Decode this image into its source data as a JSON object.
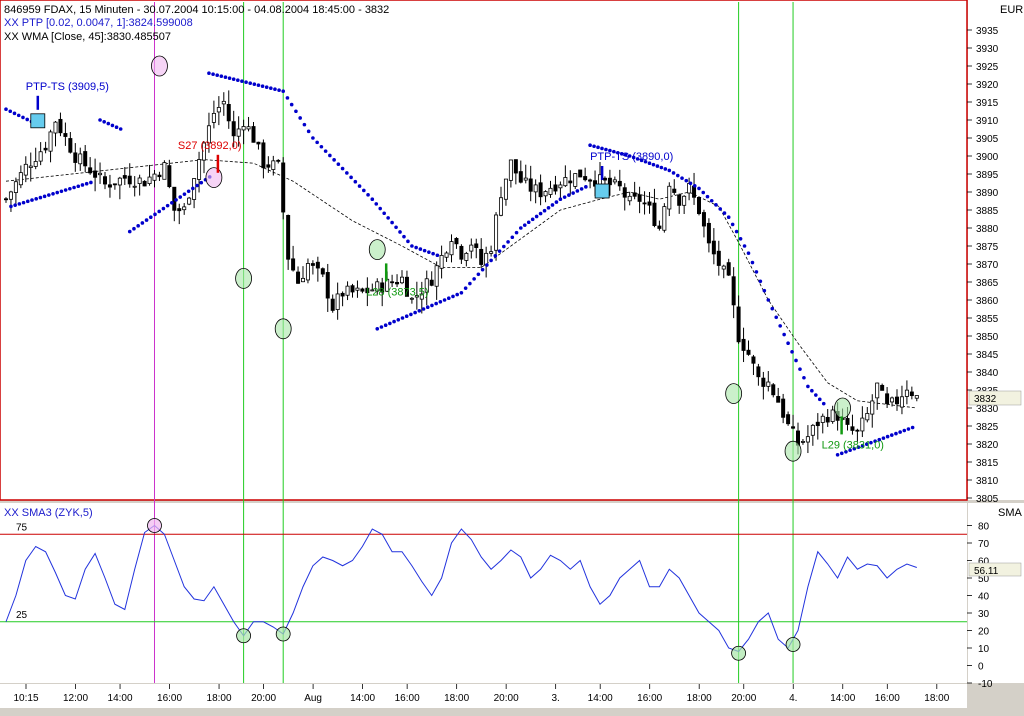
{
  "header": {
    "line1": "846959  FDAX, 15 Minuten - 30.07.2004 10:15:00 - 04.08.2004 18:45:00 - 3832",
    "line2": "XX PTP [0.02, 0.0047, 1]:3824.599008",
    "line3": "XX WMA [Close, 45]:3830.485507",
    "currency": "EUR"
  },
  "lower_header": {
    "title": "XX  SMA3 (ZYK,5)",
    "axis_title": "SMA"
  },
  "colors": {
    "candle": "#000000",
    "ptp_dots": "#0000cc",
    "wma": "#000000",
    "sma_line": "#2233dd",
    "level_line": "#cc0000",
    "green_lines": "#22cc22",
    "magenta_line": "#cc33cc",
    "short_signal": "#dd0000",
    "long_signal": "#119911",
    "circle_fill": "#a8e6a8",
    "pink_circle_fill": "#f0b8f0",
    "marker_fill": "#66ccee",
    "border_red": "#cc0000"
  },
  "chart_data": [
    {
      "type": "candlestick",
      "title": "846959  FDAX, 15 Minuten - 30.07.2004 10:15:00 - 04.08.2004 18:45:00 - 3832",
      "ylim": [
        3805,
        3940
      ],
      "yticks": [
        3805,
        3810,
        3815,
        3820,
        3825,
        3830,
        3835,
        3840,
        3845,
        3850,
        3855,
        3860,
        3865,
        3870,
        3875,
        3880,
        3885,
        3890,
        3895,
        3900,
        3905,
        3910,
        3915,
        3920,
        3925,
        3930,
        3935
      ],
      "xticks": [
        "10:15",
        "12:00",
        "14:00",
        "16:00",
        "18:00",
        "20:00",
        "Aug",
        "14:00",
        "16:00",
        "18:00",
        "20:00",
        "3.",
        "14:00",
        "16:00",
        "18:00",
        "20:00",
        "4.",
        "14:00",
        "16:00",
        "18:00"
      ],
      "last_value": "3832",
      "close_profile": [
        [
          0,
          3888
        ],
        [
          4,
          3897
        ],
        [
          8,
          3903
        ],
        [
          10,
          3910
        ],
        [
          14,
          3900
        ],
        [
          18,
          3895
        ],
        [
          20,
          3892
        ],
        [
          24,
          3894
        ],
        [
          28,
          3893
        ],
        [
          32,
          3897
        ],
        [
          34,
          3885
        ],
        [
          36,
          3885
        ],
        [
          38,
          3895
        ],
        [
          42,
          3912
        ],
        [
          44,
          3915
        ],
        [
          46,
          3905
        ],
        [
          48,
          3910
        ],
        [
          50,
          3905
        ],
        [
          52,
          3898
        ],
        [
          55,
          3897
        ],
        [
          57,
          3872
        ],
        [
          59,
          3865
        ],
        [
          61,
          3870
        ],
        [
          64,
          3866
        ],
        [
          66,
          3858
        ],
        [
          68,
          3862
        ],
        [
          72,
          3862
        ],
        [
          76,
          3864
        ],
        [
          80,
          3866
        ],
        [
          82,
          3860
        ],
        [
          84,
          3863
        ],
        [
          86,
          3866
        ],
        [
          88,
          3872
        ],
        [
          90,
          3878
        ],
        [
          92,
          3873
        ],
        [
          94,
          3876
        ],
        [
          96,
          3870
        ],
        [
          98,
          3875
        ],
        [
          100,
          3890
        ],
        [
          102,
          3898
        ],
        [
          104,
          3893
        ],
        [
          106,
          3891
        ],
        [
          108,
          3890
        ],
        [
          112,
          3893
        ],
        [
          116,
          3895
        ],
        [
          120,
          3893
        ],
        [
          124,
          3891
        ],
        [
          126,
          3887
        ],
        [
          128,
          3888
        ],
        [
          130,
          3885
        ],
        [
          132,
          3880
        ],
        [
          134,
          3893
        ],
        [
          136,
          3888
        ],
        [
          138,
          3891
        ],
        [
          140,
          3885
        ],
        [
          142,
          3875
        ],
        [
          144,
          3870
        ],
        [
          146,
          3865
        ],
        [
          148,
          3850
        ],
        [
          150,
          3845
        ],
        [
          152,
          3838
        ],
        [
          154,
          3837
        ],
        [
          156,
          3832
        ],
        [
          158,
          3825
        ],
        [
          160,
          3820
        ],
        [
          162,
          3822
        ],
        [
          164,
          3826
        ],
        [
          166,
          3828
        ],
        [
          168,
          3828
        ],
        [
          170,
          3824
        ],
        [
          172,
          3823
        ],
        [
          174,
          3828
        ],
        [
          176,
          3836
        ],
        [
          178,
          3830
        ],
        [
          180,
          3832
        ],
        [
          182,
          3836
        ],
        [
          184,
          3833
        ]
      ],
      "wma_values": [
        [
          0,
          3893
        ],
        [
          20,
          3896
        ],
        [
          40,
          3899
        ],
        [
          50,
          3898
        ],
        [
          58,
          3893
        ],
        [
          70,
          3882
        ],
        [
          80,
          3875
        ],
        [
          88,
          3869
        ],
        [
          96,
          3869
        ],
        [
          104,
          3877
        ],
        [
          112,
          3885
        ],
        [
          120,
          3888
        ],
        [
          126,
          3890
        ],
        [
          132,
          3888
        ],
        [
          138,
          3890
        ],
        [
          144,
          3886
        ],
        [
          148,
          3876
        ],
        [
          154,
          3860
        ],
        [
          160,
          3848
        ],
        [
          166,
          3837
        ],
        [
          172,
          3832
        ],
        [
          178,
          3831
        ],
        [
          184,
          3830
        ]
      ],
      "series": [
        {
          "name": "PTP [0.02, 0.0047, 1]",
          "last": "3824.599008",
          "segments": [
            [
              [
                0,
                3913
              ],
              [
                6,
                3909
              ]
            ],
            [
              [
                1,
                3886
              ],
              [
                18,
                3893
              ]
            ],
            [
              [
                19,
                3910
              ],
              [
                24,
                3907
              ]
            ],
            [
              [
                25,
                3879
              ],
              [
                42,
                3895
              ]
            ],
            [
              [
                41,
                3923
              ],
              [
                56,
                3918
              ],
              [
                62,
                3905
              ],
              [
                74,
                3888
              ],
              [
                82,
                3875
              ],
              [
                88,
                3872
              ]
            ],
            [
              [
                75,
                3852
              ],
              [
                92,
                3862
              ],
              [
                104,
                3880
              ],
              [
                112,
                3888
              ],
              [
                118,
                3892
              ]
            ],
            [
              [
                118,
                3903
              ],
              [
                126,
                3900
              ],
              [
                134,
                3896
              ],
              [
                140,
                3891
              ],
              [
                146,
                3883
              ],
              [
                150,
                3873
              ],
              [
                154,
                3860
              ],
              [
                158,
                3848
              ],
              [
                162,
                3836
              ],
              [
                166,
                3830
              ]
            ],
            [
              [
                168,
                3817
              ],
              [
                184,
                3825
              ]
            ]
          ]
        },
        {
          "name": "WMA [Close, 45]",
          "last": "3830.485507"
        }
      ],
      "annotations": [
        {
          "text": "PTP-TS (3909,5)",
          "x": 4,
          "y": 3909.5,
          "kind": "ptp"
        },
        {
          "text": "S27 (3892,0)",
          "x": 42,
          "y": 3892,
          "kind": "short"
        },
        {
          "text": "L28 (3873,5)",
          "x": 76,
          "y": 3873.5,
          "kind": "long"
        },
        {
          "text": "PTP-TS (3890,0)",
          "x": 118,
          "y": 3890,
          "kind": "ptp"
        },
        {
          "text": "L29 (3831,0)",
          "x": 168,
          "y": 3831,
          "kind": "long"
        }
      ],
      "circle_points": [
        {
          "x": 31,
          "y": 3925,
          "kind": "pink"
        },
        {
          "x": 42,
          "y": 3894,
          "kind": "pink"
        },
        {
          "x": 48,
          "y": 3866,
          "kind": "green"
        },
        {
          "x": 56,
          "y": 3852,
          "kind": "green"
        },
        {
          "x": 75,
          "y": 3874,
          "kind": "green"
        },
        {
          "x": 147,
          "y": 3834,
          "kind": "green"
        },
        {
          "x": 159,
          "y": 3818,
          "kind": "green"
        },
        {
          "x": 169,
          "y": 3830,
          "kind": "green"
        }
      ]
    },
    {
      "type": "line",
      "title": "XX  SMA3 (ZYK,5)",
      "ylim": [
        -10,
        90
      ],
      "yticks": [
        -10,
        0,
        10,
        20,
        30,
        40,
        50,
        60,
        70,
        80
      ],
      "levels": [
        {
          "value": 75,
          "label": "75"
        },
        {
          "value": 25,
          "label": "25"
        }
      ],
      "last_value": "56.11",
      "series": [
        {
          "name": "SMA3 (ZYK,5)",
          "points": [
            [
              0,
              25
            ],
            [
              2,
              40
            ],
            [
              4,
              60
            ],
            [
              6,
              68
            ],
            [
              8,
              65
            ],
            [
              10,
              53
            ],
            [
              12,
              40
            ],
            [
              14,
              38
            ],
            [
              16,
              55
            ],
            [
              18,
              64
            ],
            [
              20,
              50
            ],
            [
              22,
              35
            ],
            [
              24,
              32
            ],
            [
              26,
              55
            ],
            [
              28,
              76
            ],
            [
              30,
              80
            ],
            [
              32,
              75
            ],
            [
              34,
              60
            ],
            [
              36,
              45
            ],
            [
              38,
              38
            ],
            [
              40,
              37
            ],
            [
              42,
              45
            ],
            [
              44,
              35
            ],
            [
              46,
              25
            ],
            [
              48,
              17
            ],
            [
              50,
              25
            ],
            [
              52,
              25
            ],
            [
              54,
              22
            ],
            [
              56,
              18
            ],
            [
              58,
              30
            ],
            [
              60,
              45
            ],
            [
              62,
              57
            ],
            [
              64,
              62
            ],
            [
              66,
              60
            ],
            [
              68,
              57
            ],
            [
              70,
              60
            ],
            [
              72,
              68
            ],
            [
              74,
              78
            ],
            [
              76,
              75
            ],
            [
              78,
              65
            ],
            [
              80,
              65
            ],
            [
              82,
              57
            ],
            [
              84,
              48
            ],
            [
              86,
              40
            ],
            [
              88,
              50
            ],
            [
              90,
              70
            ],
            [
              92,
              78
            ],
            [
              94,
              72
            ],
            [
              96,
              62
            ],
            [
              98,
              55
            ],
            [
              100,
              60
            ],
            [
              102,
              66
            ],
            [
              104,
              62
            ],
            [
              106,
              50
            ],
            [
              108,
              55
            ],
            [
              110,
              63
            ],
            [
              112,
              60
            ],
            [
              114,
              55
            ],
            [
              116,
              60
            ],
            [
              118,
              45
            ],
            [
              120,
              35
            ],
            [
              122,
              40
            ],
            [
              124,
              50
            ],
            [
              126,
              55
            ],
            [
              128,
              60
            ],
            [
              130,
              45
            ],
            [
              132,
              45
            ],
            [
              134,
              55
            ],
            [
              136,
              50
            ],
            [
              138,
              40
            ],
            [
              140,
              30
            ],
            [
              142,
              25
            ],
            [
              144,
              20
            ],
            [
              146,
              10
            ],
            [
              148,
              8
            ],
            [
              150,
              15
            ],
            [
              152,
              25
            ],
            [
              154,
              30
            ],
            [
              156,
              15
            ],
            [
              158,
              10
            ],
            [
              160,
              20
            ],
            [
              162,
              45
            ],
            [
              164,
              65
            ],
            [
              166,
              58
            ],
            [
              168,
              50
            ],
            [
              170,
              62
            ],
            [
              172,
              55
            ],
            [
              174,
              58
            ],
            [
              176,
              57
            ],
            [
              178,
              50
            ],
            [
              180,
              55
            ],
            [
              182,
              58
            ],
            [
              184,
              56
            ]
          ]
        }
      ],
      "circle_points": [
        {
          "x": 30,
          "y": 80,
          "kind": "pink"
        },
        {
          "x": 48,
          "y": 17,
          "kind": "green"
        },
        {
          "x": 56,
          "y": 18,
          "kind": "green"
        },
        {
          "x": 148,
          "y": 7,
          "kind": "green"
        },
        {
          "x": 159,
          "y": 12,
          "kind": "green"
        }
      ]
    }
  ],
  "vertical_markers": [
    {
      "x": 30,
      "color": "magenta"
    },
    {
      "x": 48,
      "color": "green"
    },
    {
      "x": 56,
      "color": "green"
    },
    {
      "x": 148,
      "color": "green"
    },
    {
      "x": 159,
      "color": "green"
    }
  ]
}
